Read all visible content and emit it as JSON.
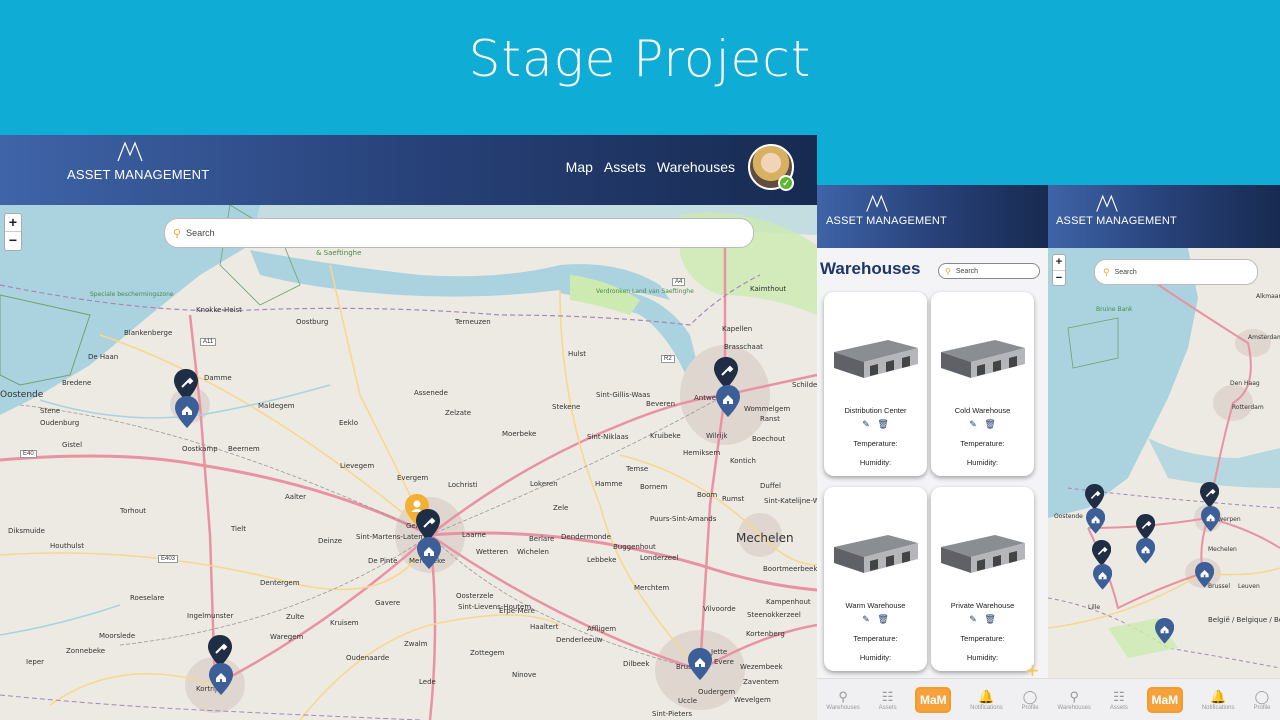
{
  "slide": {
    "title": "Stage Project"
  },
  "brand": {
    "name": "ASSET MANAGEMENT"
  },
  "main": {
    "nav": [
      "Map",
      "Assets",
      "Warehouses"
    ],
    "search_placeholder": "Search",
    "zoom_in": "+",
    "zoom_out": "−",
    "map_labels": [
      "Blankenberge",
      "Knokke-Heist",
      "Oostburg",
      "Terneuzen",
      "Hulst",
      "Kapellen",
      "Brasschaat",
      "Oostende",
      "Bredene",
      "De Haan",
      "Damme",
      "Maldegem",
      "Assenede",
      "Zelzate",
      "Stekene",
      "Sint-Gillis-Waas",
      "Beveren",
      "Antwerpen",
      "Wommelgem",
      "Stene",
      "Oudenburg",
      "Eeklo",
      "Moerbeke",
      "Sint-Niklaas",
      "Kruibeke",
      "Wilrijk",
      "Boechout",
      "Gistel",
      "Oostkamp",
      "Beernem",
      "Lievegem",
      "Evergem",
      "Lochristi",
      "Lokeren",
      "Hamme",
      "Bornem",
      "Temse",
      "Kontich",
      "Torhout",
      "Aalter",
      "Gent",
      "Laarne",
      "Berlare",
      "Zele",
      "Puurs-Sint-Amands",
      "Boom",
      "Rumst",
      "Duffel",
      "Sint-Katelijne-Waver",
      "Diksmuide",
      "Tielt",
      "Deinze",
      "Sint-Martens-Latem",
      "De Pinte",
      "Merelbeke",
      "Wetteren",
      "Wichelen",
      "Dendermonde",
      "Lebbeke",
      "Buggenhout",
      "Londerzeel",
      "Mechelen",
      "Houthulst",
      "Roeselare",
      "Dentergem",
      "Oosterzele",
      "Merchtem",
      "Boortmeerbeek",
      "Ingelmunster",
      "Zulte",
      "Gavere",
      "Kruisem",
      "Sint-Lievens-Houtem",
      "Erpe-Mere",
      "Haaltert",
      "Affligem",
      "Vilvoorde",
      "Steenokkerzeel",
      "Kampenhout",
      "Moorslede",
      "Zonnebeke",
      "Waregem",
      "Zwalm",
      "Zottegem",
      "Denderleeuw",
      "Kortenberg",
      "Ieper",
      "Kortrijk",
      "Oudenaarde",
      "Ninove",
      "Dilbeek",
      "Brussel",
      "Wezembeek",
      "Oudergem",
      "Zaventem",
      "Wevelgem",
      "Uccle",
      "Sint-Pieters",
      "Lede",
      "Jette",
      "Evere",
      "Schilde",
      "Ranst",
      "Hemiksem",
      "Kaimthout",
      "& Saeftinghe",
      "Speciale beschermingszone",
      "Verdronken Land van Saeftinghe"
    ],
    "road_labels": [
      "A11",
      "A4",
      "R2",
      "E40",
      "E403"
    ]
  },
  "phone1": {
    "title": "Warehouses",
    "search_placeholder": "Search",
    "cards": [
      {
        "name": "Distribution Center",
        "temperature_label": "Temperature:",
        "humidity_label": "Humidity:"
      },
      {
        "name": "Cold Warehouse",
        "temperature_label": "Temperature:",
        "humidity_label": "Humidity:"
      },
      {
        "name": "Warm Warehouse",
        "temperature_label": "Temperature:",
        "humidity_label": "Humidity:"
      },
      {
        "name": "Private Warehouse",
        "temperature_label": "Temperature:",
        "humidity_label": "Humidity:"
      }
    ]
  },
  "phone2": {
    "search_placeholder": "Search",
    "zoom_in": "+",
    "zoom_out": "−",
    "map_labels": [
      "Alkmaar",
      "Amsterdam",
      "Den Haag",
      "Rotterdam",
      "Oostende",
      "Antwerpen",
      "Mechelen",
      "Brussel",
      "Leuven",
      "Lille",
      "België / Belgique / Belgien",
      "Bruine Bank"
    ]
  },
  "tabbar": {
    "items": [
      {
        "label": "Warehouses",
        "icon": "pin-icon"
      },
      {
        "label": "Assets",
        "icon": "barcode-icon"
      },
      {
        "label": "MaM",
        "icon": "mam-logo"
      },
      {
        "label": "Notifications",
        "icon": "bell-icon"
      },
      {
        "label": "Profile",
        "icon": "person-icon"
      }
    ]
  },
  "colors": {
    "background": "#0fadd6",
    "header_dark": "#172a50",
    "header_light": "#3f64a8",
    "pin": "#1d3768",
    "pin_user": "#f2b035",
    "mam": "#f7a13c"
  }
}
